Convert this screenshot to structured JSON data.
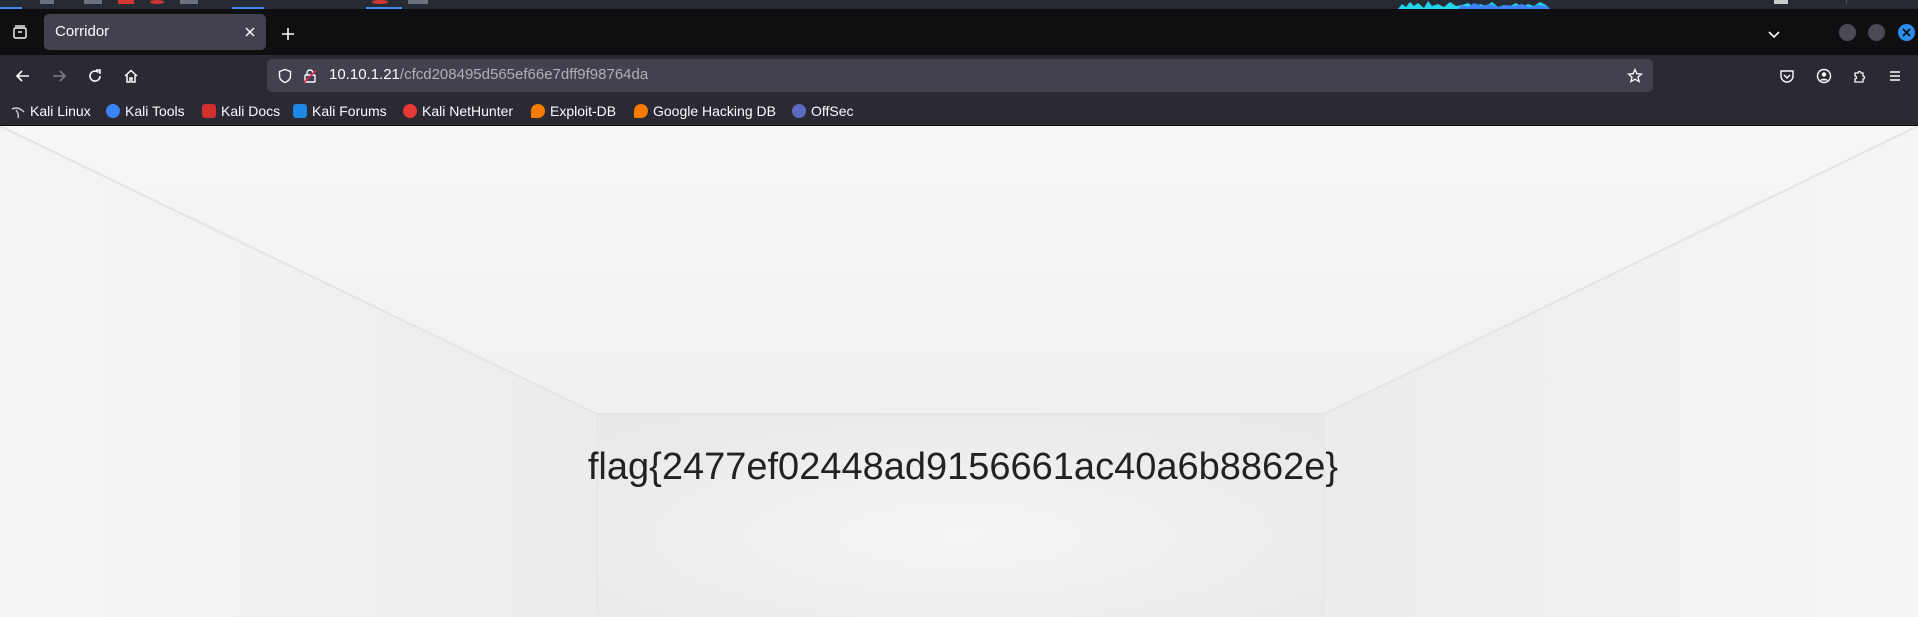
{
  "browser": {
    "tab": {
      "title": "Corridor"
    },
    "url": {
      "host": "10.10.1.21",
      "path": "/cfcd208495d565ef66e7dff9f98764da"
    },
    "icons": {
      "tab_list": "tab-list-icon",
      "close_tab": "close-icon",
      "new_tab": "plus-icon",
      "tabs_dropdown": "chevron-down-icon",
      "back": "arrow-left-icon",
      "forward": "arrow-right-icon",
      "reload": "reload-icon",
      "home": "home-icon",
      "shield": "shield-icon",
      "lock": "lock-icon",
      "bookmark_star": "star-icon",
      "pocket": "pocket-icon",
      "account": "account-icon",
      "extensions": "puzzle-icon",
      "menu": "hamburger-menu-icon"
    },
    "accent_color": "#2d8cf0"
  },
  "bookmarks": [
    {
      "label": "Kali Linux",
      "color": "#2a2a2a"
    },
    {
      "label": "Kali Tools",
      "color": "#3b82f6"
    },
    {
      "label": "Kali Docs",
      "color": "#d32f2f"
    },
    {
      "label": "Kali Forums",
      "color": "#1e88e5"
    },
    {
      "label": "Kali NetHunter",
      "color": "#e53935"
    },
    {
      "label": "Exploit-DB",
      "color": "#f57c00"
    },
    {
      "label": "Google Hacking DB",
      "color": "#f57c00"
    },
    {
      "label": "OffSec",
      "color": "#5c6bc0"
    }
  ],
  "page": {
    "flag_text": "flag{2477ef02448ad9156661ac40a6b8862e}"
  }
}
